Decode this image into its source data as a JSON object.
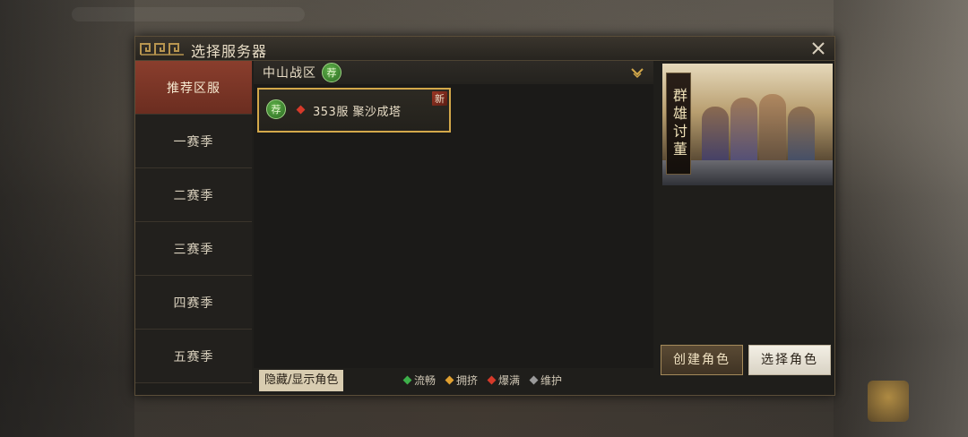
{
  "dialog": {
    "title": "选择服务器"
  },
  "sidebar": {
    "items": [
      {
        "label": "推荐区服",
        "active": true
      },
      {
        "label": "一赛季",
        "active": false
      },
      {
        "label": "二赛季",
        "active": false
      },
      {
        "label": "三赛季",
        "active": false
      },
      {
        "label": "四赛季",
        "active": false
      },
      {
        "label": "五赛季",
        "active": false
      }
    ]
  },
  "zone": {
    "name": "中山战区",
    "badge": "荐"
  },
  "server": {
    "badge": "荐",
    "label": "353服  聚沙成塔",
    "new_tag": "新",
    "status_color": "#d63a2a"
  },
  "bottom": {
    "toggle_label": "隐藏/显示角色"
  },
  "legend": [
    {
      "label": "流畅",
      "color": "#3db04a"
    },
    {
      "label": "拥挤",
      "color": "#e0a030"
    },
    {
      "label": "爆满",
      "color": "#d63a2a"
    },
    {
      "label": "维护",
      "color": "#9a9a9a"
    }
  ],
  "banner": {
    "title": "群雄讨董"
  },
  "buttons": {
    "create": "创建角色",
    "select": "选择角色"
  },
  "colors": {
    "accent_gold": "#d3a84a",
    "active_tab": "#8a3e2d"
  }
}
